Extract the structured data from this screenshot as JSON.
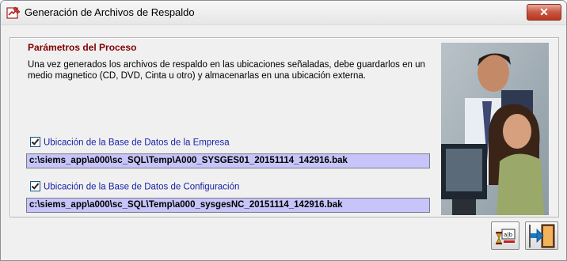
{
  "window": {
    "title": "Generación de Archivos de Respaldo",
    "close_label": "✕"
  },
  "group": {
    "legend": "Parámetros del Proceso",
    "description": "Una vez generados los archivos de respaldo en las ubicaciones señaladas, debe guardarlos en un medio magnetico (CD, DVD, Cinta u otro) y almacenarlas en una ubicación externa.",
    "company_db": {
      "label": "Ubicación de la Base de Datos de la Empresa",
      "checked": true,
      "path": "c:\\siems_app\\a000\\sc_SQL\\Temp\\A000_SYSGES01_20151114_142916.bak"
    },
    "config_db": {
      "label": "Ubicación de la Base de Datos de Configuración",
      "checked": true,
      "path": "c:\\siems_app\\a000\\sc_SQL\\Temp\\a000_sysgesNC_20151114_142916.bak"
    }
  },
  "icons": {
    "app": "backup-pencil-icon",
    "generate": "generate-backup-icon",
    "exit": "exit-door-icon"
  },
  "colors": {
    "legend": "#800000",
    "checkbox_label": "#1a23a8",
    "path_field_bg": "#c6c4f8",
    "close_button": "#c75642"
  }
}
